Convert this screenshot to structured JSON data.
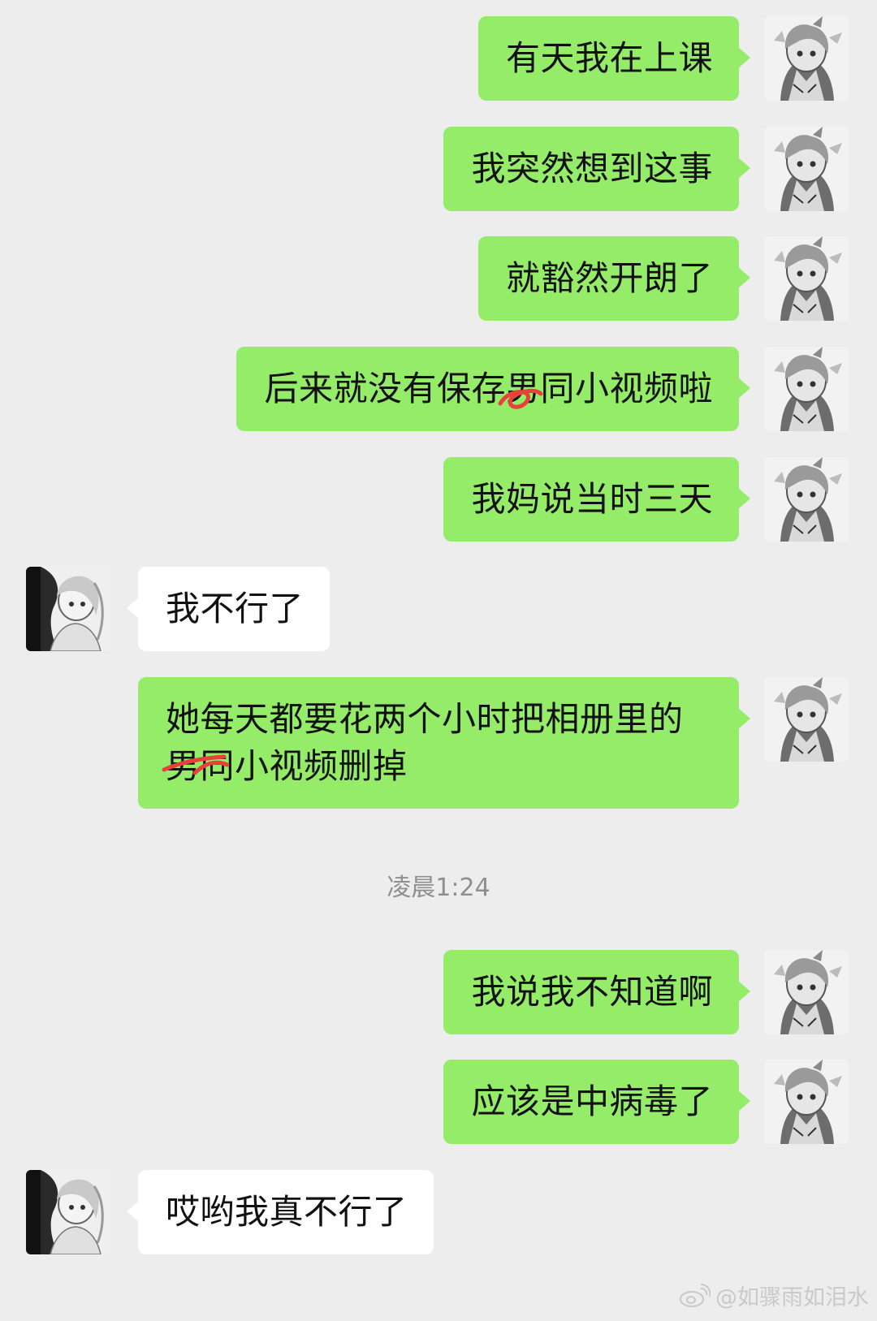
{
  "messages": [
    {
      "sender": "me",
      "text": "有天我在上课"
    },
    {
      "sender": "me",
      "text": "我突然想到这事"
    },
    {
      "sender": "me",
      "text": "就豁然开朗了"
    },
    {
      "sender": "me",
      "text": "后来就没有保存男同小视频啦"
    },
    {
      "sender": "me",
      "text": "我妈说当时三天"
    },
    {
      "sender": "other",
      "text": "我不行了"
    },
    {
      "sender": "me",
      "text_line1": "她每天都要花两个小时把相册里的",
      "text_line2": "男同小视频删掉"
    },
    {
      "sender": "me",
      "text": "我说我不知道啊"
    },
    {
      "sender": "me",
      "text": "应该是中病毒了"
    },
    {
      "sender": "other",
      "text": "哎哟我真不行了"
    }
  ],
  "timestamp": "凌晨1:24",
  "watermark": {
    "icon": "weibo-logo",
    "text": "@如骤雨如泪水"
  },
  "colors": {
    "background": "#ededed",
    "my_bubble": "#95ec69",
    "other_bubble": "#ffffff",
    "scribble": "#e8403a"
  },
  "icons": {
    "my_avatar": "anime-girl-avatar",
    "other_avatar": "anime-girl-avatar-dark"
  }
}
